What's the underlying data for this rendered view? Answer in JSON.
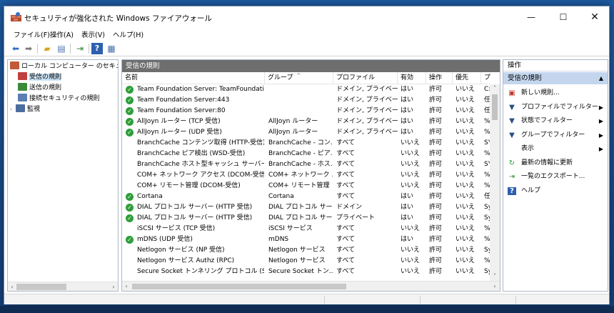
{
  "window": {
    "title": "セキュリティが強化された Windows ファイアウォール",
    "minimize_glyph": "—",
    "maximize_glyph": "☐",
    "close_glyph": "✕"
  },
  "menu": [
    "ファイル(F)",
    "操作(A)",
    "表示(V)",
    "ヘルプ(H)"
  ],
  "toolbar": {
    "icons": [
      "back-arrow-icon",
      "forward-arrow-icon",
      "up-folder-icon",
      "show-hide-tree-icon",
      "export-list-icon",
      "help-icon",
      "properties-icon"
    ]
  },
  "tree": {
    "root": "ローカル コンピューター のセキュリティ",
    "items": [
      "受信の規則",
      "送信の規則",
      "接続セキュリティの規則",
      "監視"
    ],
    "selected_index": 0
  },
  "main": {
    "header": "受信の規則",
    "columns": [
      "名前",
      "グループ",
      "プロファイル",
      "有効",
      "操作",
      "優先",
      "プロ"
    ],
    "rows": [
      {
        "checked": true,
        "name": "Team Foundation Server: TeamFoundatio...",
        "group": "",
        "profile": "ドメイン, プライベート",
        "enabled": "はい",
        "action": "許可",
        "override": "いいえ",
        "program": "C:\\"
      },
      {
        "checked": true,
        "name": "Team Foundation Server:443",
        "group": "",
        "profile": "ドメイン, プライベート",
        "enabled": "はい",
        "action": "許可",
        "override": "いいえ",
        "program": "任"
      },
      {
        "checked": true,
        "name": "Team Foundation Server:80",
        "group": "",
        "profile": "ドメイン, プライベート",
        "enabled": "はい",
        "action": "許可",
        "override": "いいえ",
        "program": "任"
      },
      {
        "checked": true,
        "name": "AllJoyn ルーター (TCP 受信)",
        "group": "AllJoyn ルーター",
        "profile": "ドメイン, プライベート",
        "enabled": "はい",
        "action": "許可",
        "override": "いいえ",
        "program": "%S"
      },
      {
        "checked": true,
        "name": "AllJoyn ルーター (UDP 受信)",
        "group": "AllJoyn ルーター",
        "profile": "ドメイン, プライベート",
        "enabled": "はい",
        "action": "許可",
        "override": "いいえ",
        "program": "%S"
      },
      {
        "checked": false,
        "name": "BranchCache コンテンツ取得 (HTTP-受信)",
        "group": "BranchCache - コン...",
        "profile": "すべて",
        "enabled": "いいえ",
        "action": "許可",
        "override": "いいえ",
        "program": "SY"
      },
      {
        "checked": false,
        "name": "BranchCache ピア検出 (WSD-受信)",
        "group": "BranchCache - ピア...",
        "profile": "すべて",
        "enabled": "いいえ",
        "action": "許可",
        "override": "いいえ",
        "program": "%s"
      },
      {
        "checked": false,
        "name": "BranchCache ホスト型キャッシュ サーバー (HT...",
        "group": "BranchCache - ホス...",
        "profile": "すべて",
        "enabled": "いいえ",
        "action": "許可",
        "override": "いいえ",
        "program": "SY"
      },
      {
        "checked": false,
        "name": "COM+ ネットワーク アクセス (DCOM-受信)",
        "group": "COM+ ネットワーク ...",
        "profile": "すべて",
        "enabled": "いいえ",
        "action": "許可",
        "override": "いいえ",
        "program": "%s"
      },
      {
        "checked": false,
        "name": "COM+ リモート管理 (DCOM-受信)",
        "group": "COM+ リモート管理",
        "profile": "すべて",
        "enabled": "いいえ",
        "action": "許可",
        "override": "いいえ",
        "program": "%s"
      },
      {
        "checked": true,
        "name": "Cortana",
        "group": "Cortana",
        "profile": "すべて",
        "enabled": "はい",
        "action": "許可",
        "override": "いいえ",
        "program": "任"
      },
      {
        "checked": true,
        "name": "DIAL プロトコル サーバー (HTTP 受信)",
        "group": "DIAL プロトコル サー...",
        "profile": "ドメイン",
        "enabled": "はい",
        "action": "許可",
        "override": "いいえ",
        "program": "Sy"
      },
      {
        "checked": true,
        "name": "DIAL プロトコル サーバー (HTTP 受信)",
        "group": "DIAL プロトコル サー...",
        "profile": "プライベート",
        "enabled": "はい",
        "action": "許可",
        "override": "いいえ",
        "program": "Sy"
      },
      {
        "checked": false,
        "name": "iSCSI サービス (TCP 受信)",
        "group": "iSCSI サービス",
        "profile": "すべて",
        "enabled": "いいえ",
        "action": "許可",
        "override": "いいえ",
        "program": "%S"
      },
      {
        "checked": true,
        "name": "mDNS (UDP 受信)",
        "group": "mDNS",
        "profile": "すべて",
        "enabled": "はい",
        "action": "許可",
        "override": "いいえ",
        "program": "%S"
      },
      {
        "checked": false,
        "name": "Netlogon サービス (NP 受信)",
        "group": "Netlogon サービス",
        "profile": "すべて",
        "enabled": "いいえ",
        "action": "許可",
        "override": "いいえ",
        "program": "Sy"
      },
      {
        "checked": false,
        "name": "Netlogon サービス Authz (RPC)",
        "group": "Netlogon サービス",
        "profile": "すべて",
        "enabled": "いいえ",
        "action": "許可",
        "override": "いいえ",
        "program": "%S"
      },
      {
        "checked": false,
        "name": "Secure Socket トンネリング プロトコル (SSTP ...",
        "group": "Secure Socket トン...",
        "profile": "すべて",
        "enabled": "いいえ",
        "action": "許可",
        "override": "いいえ",
        "program": "Sy"
      }
    ]
  },
  "actions": {
    "title": "操作",
    "section": "受信の規則",
    "items": [
      {
        "icon": "new-rule-icon",
        "label": "新しい規則...",
        "submenu": false
      },
      {
        "icon": "filter-icon",
        "label": "プロファイルでフィルター",
        "submenu": true
      },
      {
        "icon": "filter-icon",
        "label": "状態でフィルター",
        "submenu": true
      },
      {
        "icon": "filter-icon",
        "label": "グループでフィルター",
        "submenu": true
      },
      {
        "icon": "",
        "label": "表示",
        "submenu": true
      },
      {
        "icon": "refresh-icon",
        "label": "最新の情報に更新",
        "submenu": false
      },
      {
        "icon": "export-list-icon",
        "label": "一覧のエクスポート...",
        "submenu": false
      },
      {
        "icon": "help-icon",
        "label": "ヘルプ",
        "submenu": false
      }
    ]
  },
  "colors": {
    "check_green": "#2e9e3a",
    "header_gray": "#6e6e6e",
    "selection_blue": "#c4d6ee"
  }
}
